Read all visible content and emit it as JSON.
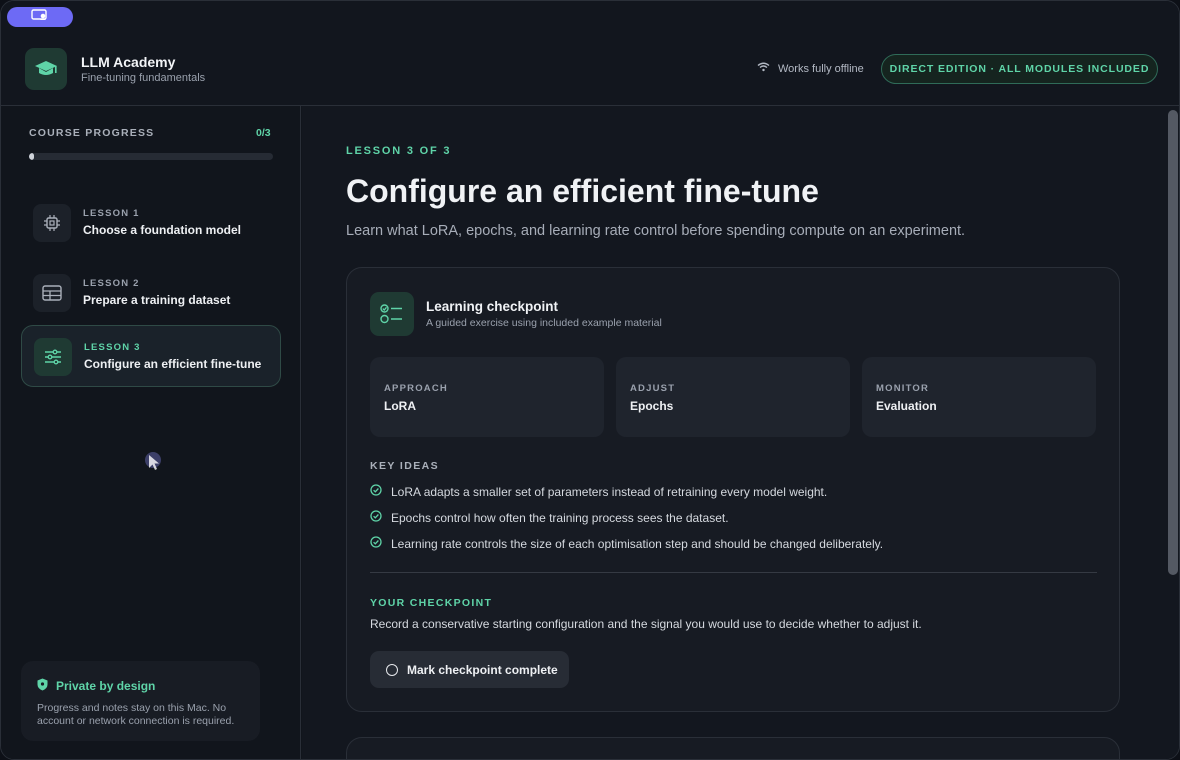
{
  "header": {
    "app_title": "LLM Academy",
    "app_subtitle": "Fine-tuning fundamentals",
    "offline_text": "Works fully offline",
    "edition_badge": "DIRECT EDITION · ALL MODULES INCLUDED"
  },
  "sidebar": {
    "progress_label": "COURSE PROGRESS",
    "progress_count": "0/3",
    "progress_fraction": 0.02,
    "lessons": [
      {
        "number": "LESSON 1",
        "title": "Choose a foundation model",
        "icon": "chip-icon",
        "active": false
      },
      {
        "number": "LESSON 2",
        "title": "Prepare a training dataset",
        "icon": "table-icon",
        "active": false
      },
      {
        "number": "LESSON 3",
        "title": "Configure an efficient fine-tune",
        "icon": "sliders-icon",
        "active": true
      }
    ],
    "privacy": {
      "title": "Private by design",
      "text": "Progress and notes stay on this Mac. No account or network connection is required."
    }
  },
  "main": {
    "eyebrow": "LESSON 3 OF 3",
    "title": "Configure an efficient fine-tune",
    "subtitle": "Learn what LoRA, epochs, and learning rate control before spending compute on an experiment.",
    "checkpoint_card": {
      "title": "Learning checkpoint",
      "subtitle": "A guided exercise using included example material",
      "tiles": [
        {
          "label": "APPROACH",
          "value": "LoRA"
        },
        {
          "label": "ADJUST",
          "value": "Epochs"
        },
        {
          "label": "MONITOR",
          "value": "Evaluation"
        }
      ],
      "key_ideas_label": "KEY IDEAS",
      "key_ideas": [
        "LoRA adapts a smaller set of parameters instead of retraining every model weight.",
        "Epochs control how often the training process sees the dataset.",
        "Learning rate controls the size of each optimisation step and should be changed deliberately."
      ],
      "your_checkpoint_label": "YOUR CHECKPOINT",
      "your_checkpoint_text": "Record a conservative starting configuration and the signal you would use to decide whether to adjust it.",
      "mark_button": "Mark checkpoint complete"
    }
  },
  "colors": {
    "accent": "#5fd4a8",
    "pill": "#6d6af5",
    "background": "#11151c"
  }
}
